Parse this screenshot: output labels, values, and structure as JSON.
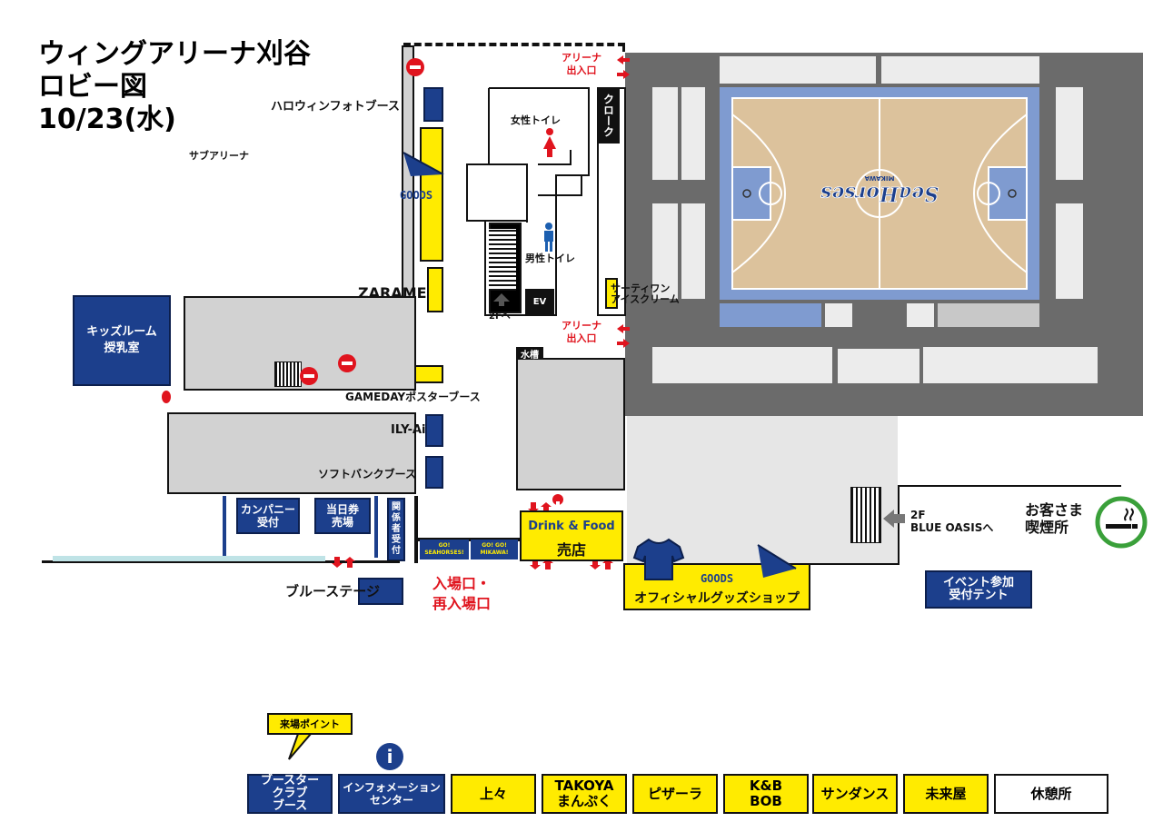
{
  "title": {
    "line1": "ウィングアリーナ刈谷",
    "line2": "ロビー図",
    "line3": "10/23(水)"
  },
  "labels": {
    "sub_arena": "サブアリーナ",
    "halloween": "ハロウィンフォトブース",
    "goods_flag": "GOODS",
    "zarame": "ZARAME",
    "female_toilet": "女性トイレ",
    "male_toilet": "男性トイレ",
    "cloak": "クローク",
    "arena_entrance_top": "アリーナ\n出入口",
    "arena_entrance_mid": "アリーナ\n出入口",
    "thirty_one": "サーティワン\nアイスクリーム",
    "to_2f": "2Fへ",
    "ev": "EV",
    "water_tank": "水槽",
    "kids_room": "キッズルーム\n授乳室",
    "gameday_poster": "GAMEDAYポスターブース",
    "ily_ai": "ILY-Ai",
    "softbank": "ソフトバンクブース",
    "company_reception": "カンパニー\n受付",
    "same_day_ticket": "当日券\n売場",
    "staff_reception": "関\n係\n者\n受\n付",
    "banner_left": "GO!\nSEAHORSES!",
    "banner_right": "GO! GO!\nMIKAWA!",
    "blue_stage": "ブルーステージ",
    "entrance": "入場口・\n再入場口",
    "drink_food_en": "Drink & Food",
    "drink_food_ja": "売店",
    "goods_en": "GOODS",
    "goods_ja": "オフィシャルグッズショップ",
    "blue_oasis": "2F\nBLUE OASISへ",
    "smoking": "お客さま\n喫煙所",
    "event_tent": "イベント参加\n受付テント",
    "court_logo": "SeaHorses",
    "court_logo_sub": "MIKAWA"
  },
  "legend": {
    "callout": "来場ポイント",
    "info_icon": "i",
    "items": [
      "ブースター\nクラブ\nブース",
      "インフォメーション\nセンター",
      "上々",
      "TAKOYA\nまんぷく",
      "ピザーラ",
      "K&B\nBOB",
      "サンダンス",
      "未来屋",
      "休憩所"
    ]
  },
  "colors": {
    "navy": "#1c3f8c",
    "yellow": "#ffeb00",
    "red": "#e0141e",
    "gray": "#d2d2d2",
    "arena_dark": "#6b6b6b",
    "court_wood": "#dcc29c",
    "court_blue": "#7f9bd0",
    "smoking_green": "#3aa03a"
  }
}
